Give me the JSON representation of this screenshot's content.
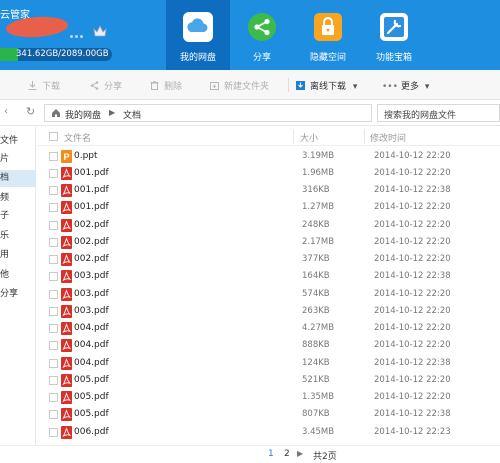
{
  "header": {
    "app_title": "云管家",
    "quota_text": "341.62GB/2089.00GB",
    "quota_used_fraction": 0.1635,
    "nav": [
      {
        "label": "我的网盘",
        "icon": "cloud-icon",
        "color": "#ffffff",
        "active": true
      },
      {
        "label": "分享",
        "icon": "share-icon",
        "color": "#3dbb4a",
        "active": false
      },
      {
        "label": "隐藏空间",
        "icon": "lock-icon",
        "color": "#f7a623",
        "active": false
      },
      {
        "label": "功能宝箱",
        "icon": "toolbox-icon",
        "color": "#ffffff",
        "active": false
      }
    ]
  },
  "toolbar": {
    "download": "下载",
    "share": "分享",
    "delete": "删除",
    "new_folder": "新建文件夹",
    "offline_download": "离线下载",
    "more": "更多"
  },
  "address": {
    "root": "我的网盘",
    "current": "文档",
    "search_placeholder": "搜索我的网盘文件"
  },
  "sidebar": {
    "items": [
      {
        "label": "文件",
        "active": false
      },
      {
        "label": "片",
        "active": false
      },
      {
        "label": "档",
        "active": true
      },
      {
        "label": "频",
        "active": false
      },
      {
        "label": "子",
        "active": false
      },
      {
        "label": "乐",
        "active": false
      },
      {
        "label": "用",
        "active": false
      },
      {
        "label": "他",
        "active": false
      },
      {
        "label": "分享",
        "active": false
      }
    ]
  },
  "columns": {
    "name": "文件名",
    "size": "大小",
    "modified": "修改时间"
  },
  "files": [
    {
      "name": "0.ppt",
      "type": "ppt",
      "size": "3.19MB",
      "modified": "2014-10-12 22:20"
    },
    {
      "name": "001.pdf",
      "type": "pdf",
      "size": "1.96MB",
      "modified": "2014-10-12 22:20"
    },
    {
      "name": "001.pdf",
      "type": "pdf",
      "size": "316KB",
      "modified": "2014-10-12 22:38"
    },
    {
      "name": "001.pdf",
      "type": "pdf",
      "size": "1.27MB",
      "modified": "2014-10-12 22:20"
    },
    {
      "name": "002.pdf",
      "type": "pdf",
      "size": "248KB",
      "modified": "2014-10-12 22:20"
    },
    {
      "name": "002.pdf",
      "type": "pdf",
      "size": "2.17MB",
      "modified": "2014-10-12 22:20"
    },
    {
      "name": "002.pdf",
      "type": "pdf",
      "size": "377KB",
      "modified": "2014-10-12 22:20"
    },
    {
      "name": "003.pdf",
      "type": "pdf",
      "size": "164KB",
      "modified": "2014-10-12 22:38"
    },
    {
      "name": "003.pdf",
      "type": "pdf",
      "size": "574KB",
      "modified": "2014-10-12 22:20"
    },
    {
      "name": "003.pdf",
      "type": "pdf",
      "size": "263KB",
      "modified": "2014-10-12 22:20"
    },
    {
      "name": "004.pdf",
      "type": "pdf",
      "size": "4.27MB",
      "modified": "2014-10-12 22:20"
    },
    {
      "name": "004.pdf",
      "type": "pdf",
      "size": "888KB",
      "modified": "2014-10-12 22:20"
    },
    {
      "name": "004.pdf",
      "type": "pdf",
      "size": "124KB",
      "modified": "2014-10-12 22:38"
    },
    {
      "name": "005.pdf",
      "type": "pdf",
      "size": "521KB",
      "modified": "2014-10-12 22:20"
    },
    {
      "name": "005.pdf",
      "type": "pdf",
      "size": "1.35MB",
      "modified": "2014-10-12 22:20"
    },
    {
      "name": "005.pdf",
      "type": "pdf",
      "size": "807KB",
      "modified": "2014-10-12 22:38"
    },
    {
      "name": "006.pdf",
      "type": "pdf",
      "size": "3.45MB",
      "modified": "2014-10-12 22:23"
    }
  ],
  "pagination": {
    "page1": "1",
    "page2": "2",
    "next_icon": "chevron-right-icon",
    "total": "共2页"
  },
  "colors": {
    "brand": "#1e8fe0",
    "pdf": "#d9302a",
    "ppt": "#f28d1a",
    "quota_fill": "#2ab54c"
  }
}
